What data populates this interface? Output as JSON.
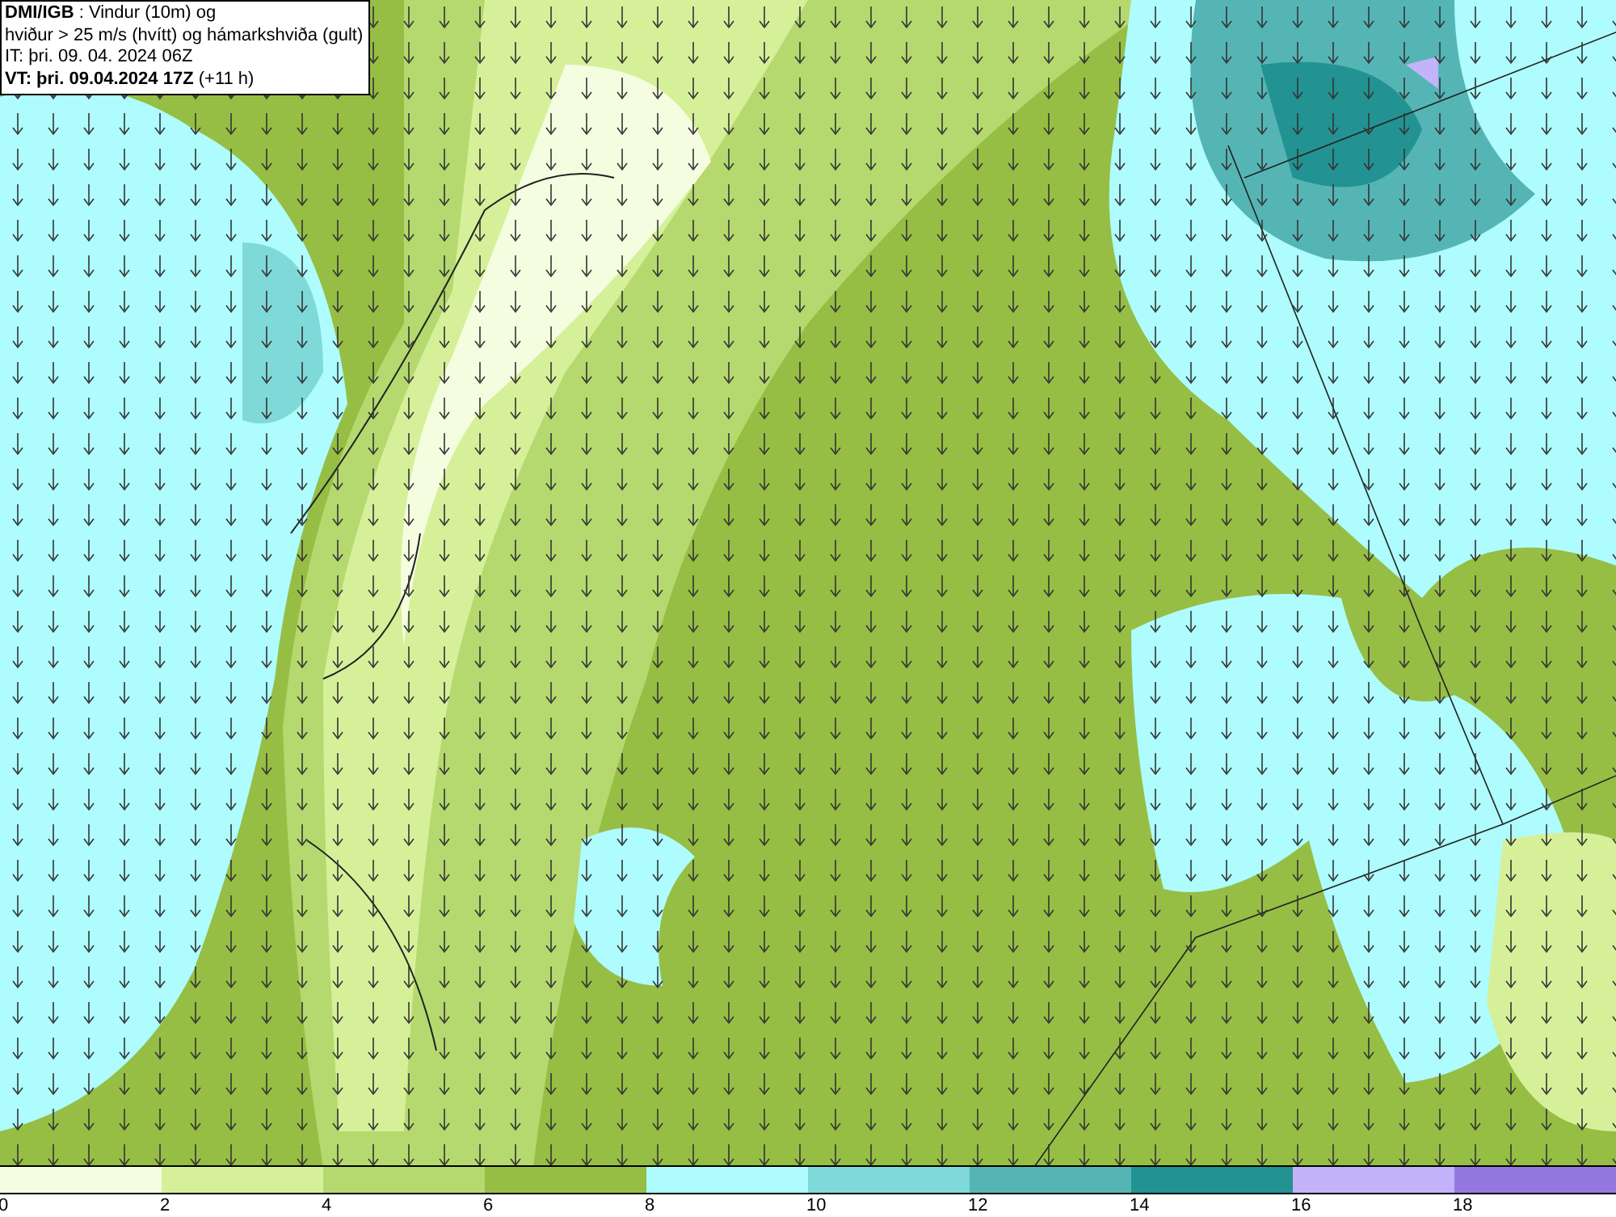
{
  "header": {
    "lines": [
      "**DMI/IGB** : Vindur (10m) og",
      "hviður > 25 m/s (hvítt) og hámarkshviða (gult)",
      "IT: þri. 09. 04. 2024 06Z",
      "**VT: þri. 09.04.2024 17Z** (+11 h)"
    ]
  },
  "legend": {
    "bins": [
      {
        "color": "#f5fde0"
      },
      {
        "color": "#d6f09a"
      },
      {
        "color": "#b5d96e"
      },
      {
        "color": "#96be44"
      },
      {
        "color": "#aefcfd"
      },
      {
        "color": "#7fd9d9"
      },
      {
        "color": "#55b5b5"
      },
      {
        "color": "#239292"
      },
      {
        "color": "#c2b3fa"
      },
      {
        "color": "#9478e0"
      }
    ],
    "ticks": [
      "0",
      "2",
      "4",
      "6",
      "8",
      "10",
      "12",
      "14",
      "16",
      "18"
    ]
  }
}
